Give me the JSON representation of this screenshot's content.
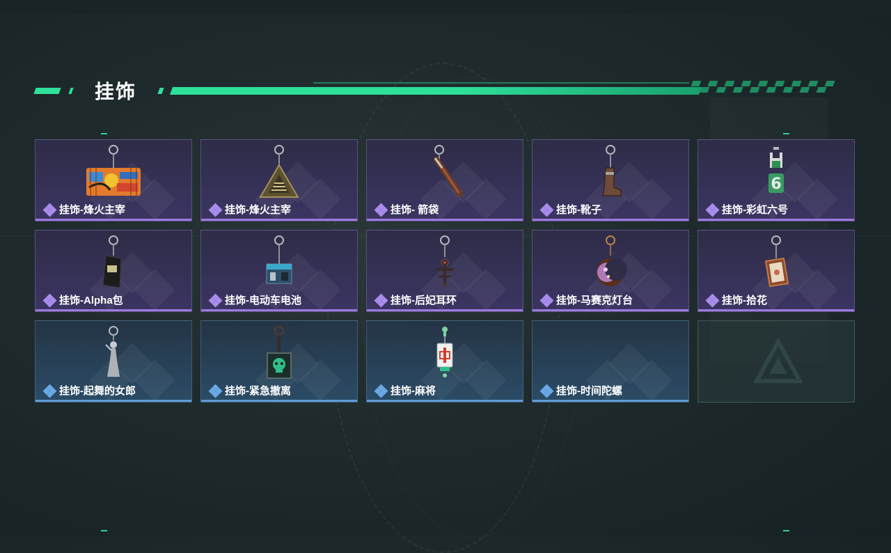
{
  "header": {
    "title": "挂饰"
  },
  "items": [
    {
      "label": "挂饰-烽火主宰",
      "rarity": "purple",
      "icon": "graffiti-bus-charm-icon"
    },
    {
      "label": "挂饰-烽火主宰",
      "rarity": "purple",
      "icon": "triangle-emblem-charm-icon"
    },
    {
      "label": "挂饰- 箭袋",
      "rarity": "purple",
      "icon": "quiver-charm-icon"
    },
    {
      "label": "挂饰-靴子",
      "rarity": "purple",
      "icon": "boot-charm-icon"
    },
    {
      "label": "挂饰-彩虹六号",
      "rarity": "purple",
      "icon": "rainbow-six-charm-icon"
    },
    {
      "label": "挂饰-Alpha包",
      "rarity": "purple",
      "icon": "alpha-bag-charm-icon"
    },
    {
      "label": "挂饰-电动车电池",
      "rarity": "purple",
      "icon": "battery-charm-icon"
    },
    {
      "label": "挂饰-后妃耳环",
      "rarity": "purple",
      "icon": "earring-charm-icon"
    },
    {
      "label": "挂饰-马赛克灯台",
      "rarity": "purple",
      "icon": "mosaic-lamp-charm-icon"
    },
    {
      "label": "挂饰-拾花",
      "rarity": "purple",
      "icon": "picture-frame-charm-icon"
    },
    {
      "label": "挂饰-起舞的女郎",
      "rarity": "blue",
      "icon": "dancing-lady-charm-icon"
    },
    {
      "label": "挂饰-紧急撤离",
      "rarity": "blue",
      "icon": "skull-box-charm-icon"
    },
    {
      "label": "挂饰-麻将",
      "rarity": "blue",
      "icon": "mahjong-tile-charm-icon"
    },
    {
      "label": "挂饰-时间陀螺",
      "rarity": "blue",
      "icon": ""
    },
    {
      "label": "",
      "rarity": "empty",
      "icon": "empty-slot-logo-icon"
    }
  ],
  "colors": {
    "accent": "#2ee09a",
    "purple": "#9d7ae0",
    "blue": "#5e9bd6"
  }
}
